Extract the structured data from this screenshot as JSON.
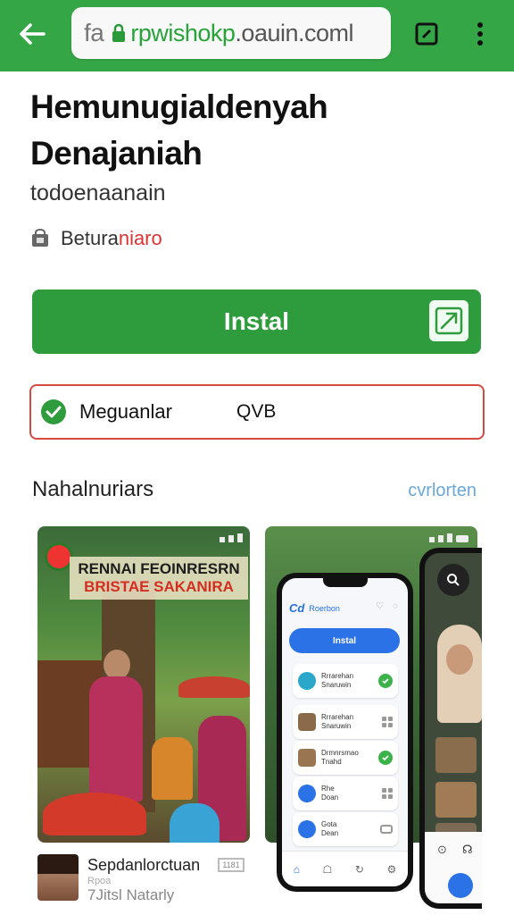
{
  "browser": {
    "url_prefix": "fa",
    "url": "rpwishokp.oauin.coml",
    "url_domain_part": "rpwishokp",
    "url_rest": ".oauin.coml"
  },
  "app": {
    "title": "Hemunugialdenyah Denajaniah",
    "developer": "todoenaanain",
    "category_part1": "Betura",
    "category_part2": "niaro"
  },
  "install": {
    "label": "Instal"
  },
  "verify": {
    "label": "Meguanlar",
    "code": "QVB"
  },
  "screenshots_section": {
    "title": "Nahalnuriars",
    "link": "cvrlorten"
  },
  "screenshot1": {
    "banner_line1": "RENNAI FEOINRESRN",
    "banner_line2": "BRISTAE SAKANIRA"
  },
  "phone": {
    "logo": "Cd",
    "title": "Roerbon",
    "install_label": "Instal",
    "cards": [
      {
        "text": "Rrrarehan\nSnaruwin"
      },
      {
        "text": "Rrrarehan\nSnaruwin"
      },
      {
        "text": "Drmnrsmao\nTnahd"
      },
      {
        "text": "Rhe\nDoan"
      },
      {
        "text": "Gota\nDean"
      }
    ]
  },
  "review": {
    "name": "Sepdanlorctuan",
    "badge": "1181",
    "sub1": "Rpoa",
    "sub2": "7Jitsl Natarly"
  },
  "colors": {
    "toolbar_green": "#35a646",
    "install_green": "#2e9c3d",
    "verify_border": "#d44b40",
    "link_blue": "#6aa8d6"
  },
  "icons": [
    "back-arrow-icon",
    "lock-icon",
    "tabs-icon",
    "more-vert-icon",
    "store-icon",
    "share-icon",
    "check-circle-icon"
  ]
}
